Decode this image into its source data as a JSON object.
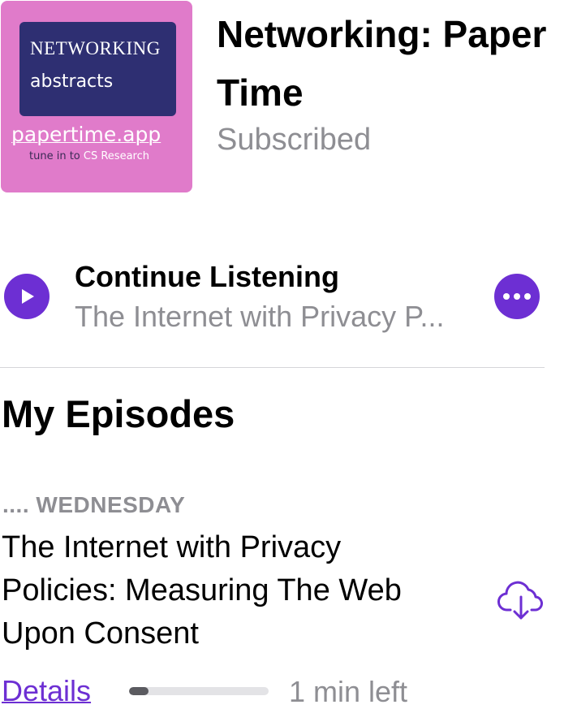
{
  "podcast": {
    "artwork": {
      "line1": "NETWORKING",
      "line2": "abstracts",
      "site": "papertime.app",
      "tagline_prefix": "tune in to",
      "tagline_highlight": "CS Research",
      "background_color": "#e07bca",
      "panel_color": "#2e2f72"
    },
    "title": "Networking: Paper Time",
    "status": "Subscribed"
  },
  "continue_listening": {
    "title": "Continue Listening",
    "subtitle": "The Internet with Privacy P...",
    "play_icon": "play-icon",
    "more_icon": "ellipsis-icon"
  },
  "my_episodes": {
    "heading": "My Episodes",
    "episodes": [
      {
        "status_dots": "....",
        "day": "WEDNESDAY",
        "title": "The Internet with Privacy Policies: Measuring The Web Upon Consent",
        "details_label": "Details",
        "progress": 0.14,
        "time_left": "1 min left",
        "download_icon": "cloud-download-icon"
      }
    ]
  },
  "colors": {
    "accent": "#6d2fd3",
    "secondary_text": "#8e8e93"
  }
}
